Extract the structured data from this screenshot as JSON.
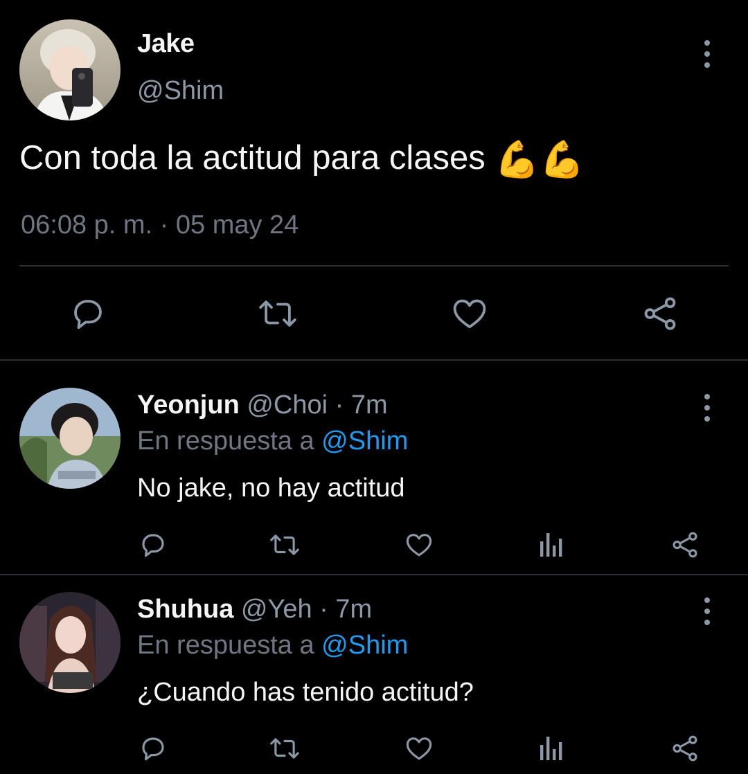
{
  "main_tweet": {
    "name": "Jake",
    "handle": "@Shim",
    "text": "Con toda la actitud para clases",
    "emoji": "💪💪",
    "timestamp": "06:08 p. m. · 05 may 24",
    "actions": [
      "reply-icon",
      "retweet-icon",
      "like-icon",
      "share-icon"
    ]
  },
  "replies": [
    {
      "name": "Yeonjun",
      "handle": "@Choi",
      "time": "· 7m",
      "in_reply_prefix": "En respuesta a",
      "in_reply_mention": "@Shim",
      "text": "No jake, no hay actitud"
    },
    {
      "name": "Shuhua",
      "handle": "@Yeh",
      "time": "· 7m",
      "in_reply_prefix": "En respuesta a",
      "in_reply_mention": "@Shim",
      "text": "¿Cuando has tenido actitud?"
    }
  ],
  "colors": {
    "background": "#000000",
    "text": "#f5f5f5",
    "muted": "#8b98a5",
    "accent": "#1d9bf0",
    "icon": "#8b98a5"
  }
}
